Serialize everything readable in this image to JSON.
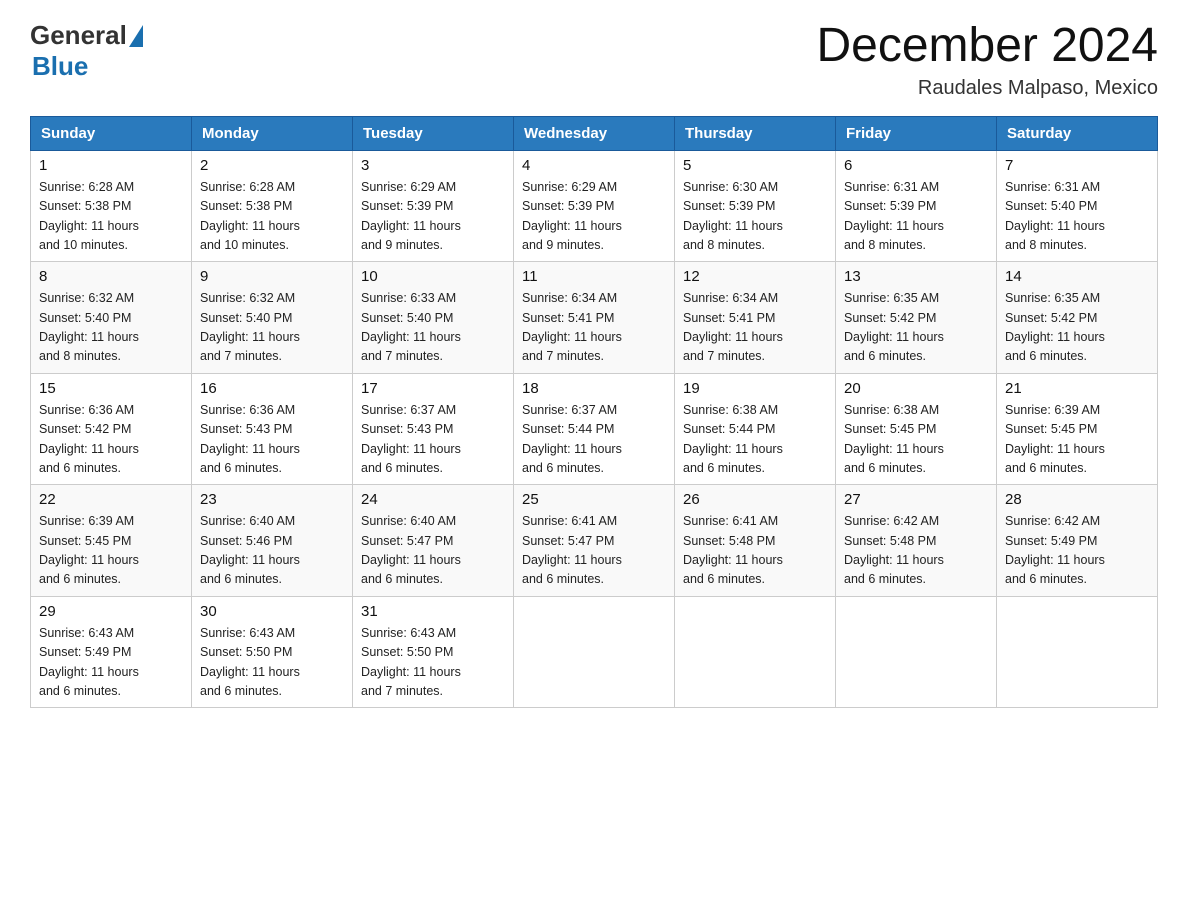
{
  "logo": {
    "text_general": "General",
    "text_blue": "Blue"
  },
  "header": {
    "month_title": "December 2024",
    "location": "Raudales Malpaso, Mexico"
  },
  "days_of_week": [
    "Sunday",
    "Monday",
    "Tuesday",
    "Wednesday",
    "Thursday",
    "Friday",
    "Saturday"
  ],
  "weeks": [
    [
      {
        "day": "1",
        "sunrise": "6:28 AM",
        "sunset": "5:38 PM",
        "daylight": "11 hours and 10 minutes."
      },
      {
        "day": "2",
        "sunrise": "6:28 AM",
        "sunset": "5:38 PM",
        "daylight": "11 hours and 10 minutes."
      },
      {
        "day": "3",
        "sunrise": "6:29 AM",
        "sunset": "5:39 PM",
        "daylight": "11 hours and 9 minutes."
      },
      {
        "day": "4",
        "sunrise": "6:29 AM",
        "sunset": "5:39 PM",
        "daylight": "11 hours and 9 minutes."
      },
      {
        "day": "5",
        "sunrise": "6:30 AM",
        "sunset": "5:39 PM",
        "daylight": "11 hours and 8 minutes."
      },
      {
        "day": "6",
        "sunrise": "6:31 AM",
        "sunset": "5:39 PM",
        "daylight": "11 hours and 8 minutes."
      },
      {
        "day": "7",
        "sunrise": "6:31 AM",
        "sunset": "5:40 PM",
        "daylight": "11 hours and 8 minutes."
      }
    ],
    [
      {
        "day": "8",
        "sunrise": "6:32 AM",
        "sunset": "5:40 PM",
        "daylight": "11 hours and 8 minutes."
      },
      {
        "day": "9",
        "sunrise": "6:32 AM",
        "sunset": "5:40 PM",
        "daylight": "11 hours and 7 minutes."
      },
      {
        "day": "10",
        "sunrise": "6:33 AM",
        "sunset": "5:40 PM",
        "daylight": "11 hours and 7 minutes."
      },
      {
        "day": "11",
        "sunrise": "6:34 AM",
        "sunset": "5:41 PM",
        "daylight": "11 hours and 7 minutes."
      },
      {
        "day": "12",
        "sunrise": "6:34 AM",
        "sunset": "5:41 PM",
        "daylight": "11 hours and 7 minutes."
      },
      {
        "day": "13",
        "sunrise": "6:35 AM",
        "sunset": "5:42 PM",
        "daylight": "11 hours and 6 minutes."
      },
      {
        "day": "14",
        "sunrise": "6:35 AM",
        "sunset": "5:42 PM",
        "daylight": "11 hours and 6 minutes."
      }
    ],
    [
      {
        "day": "15",
        "sunrise": "6:36 AM",
        "sunset": "5:42 PM",
        "daylight": "11 hours and 6 minutes."
      },
      {
        "day": "16",
        "sunrise": "6:36 AM",
        "sunset": "5:43 PM",
        "daylight": "11 hours and 6 minutes."
      },
      {
        "day": "17",
        "sunrise": "6:37 AM",
        "sunset": "5:43 PM",
        "daylight": "11 hours and 6 minutes."
      },
      {
        "day": "18",
        "sunrise": "6:37 AM",
        "sunset": "5:44 PM",
        "daylight": "11 hours and 6 minutes."
      },
      {
        "day": "19",
        "sunrise": "6:38 AM",
        "sunset": "5:44 PM",
        "daylight": "11 hours and 6 minutes."
      },
      {
        "day": "20",
        "sunrise": "6:38 AM",
        "sunset": "5:45 PM",
        "daylight": "11 hours and 6 minutes."
      },
      {
        "day": "21",
        "sunrise": "6:39 AM",
        "sunset": "5:45 PM",
        "daylight": "11 hours and 6 minutes."
      }
    ],
    [
      {
        "day": "22",
        "sunrise": "6:39 AM",
        "sunset": "5:45 PM",
        "daylight": "11 hours and 6 minutes."
      },
      {
        "day": "23",
        "sunrise": "6:40 AM",
        "sunset": "5:46 PM",
        "daylight": "11 hours and 6 minutes."
      },
      {
        "day": "24",
        "sunrise": "6:40 AM",
        "sunset": "5:47 PM",
        "daylight": "11 hours and 6 minutes."
      },
      {
        "day": "25",
        "sunrise": "6:41 AM",
        "sunset": "5:47 PM",
        "daylight": "11 hours and 6 minutes."
      },
      {
        "day": "26",
        "sunrise": "6:41 AM",
        "sunset": "5:48 PM",
        "daylight": "11 hours and 6 minutes."
      },
      {
        "day": "27",
        "sunrise": "6:42 AM",
        "sunset": "5:48 PM",
        "daylight": "11 hours and 6 minutes."
      },
      {
        "day": "28",
        "sunrise": "6:42 AM",
        "sunset": "5:49 PM",
        "daylight": "11 hours and 6 minutes."
      }
    ],
    [
      {
        "day": "29",
        "sunrise": "6:43 AM",
        "sunset": "5:49 PM",
        "daylight": "11 hours and 6 minutes."
      },
      {
        "day": "30",
        "sunrise": "6:43 AM",
        "sunset": "5:50 PM",
        "daylight": "11 hours and 6 minutes."
      },
      {
        "day": "31",
        "sunrise": "6:43 AM",
        "sunset": "5:50 PM",
        "daylight": "11 hours and 7 minutes."
      },
      null,
      null,
      null,
      null
    ]
  ],
  "labels": {
    "sunrise": "Sunrise:",
    "sunset": "Sunset:",
    "daylight": "Daylight:"
  }
}
